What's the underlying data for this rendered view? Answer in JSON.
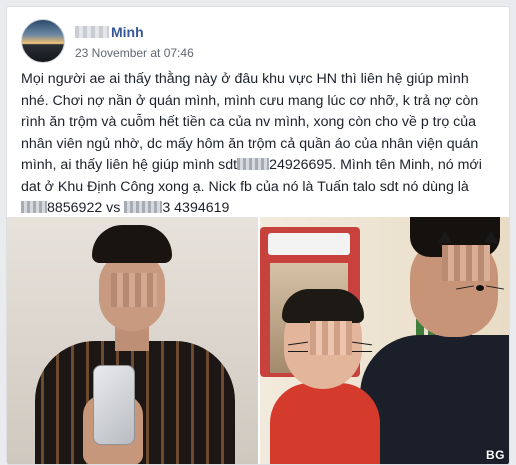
{
  "post": {
    "author": {
      "name_visible": "Minh",
      "avatar_icon": "profile-avatar-icon"
    },
    "timestamp": "23 November at 07:46",
    "lines": [
      "Mọi người ae ai thấy thằng này ở đâu khu vực HN thì liên hệ giúp mình",
      "nhé. Chơi nợ nần ở quán mình, mình cưu mang lúc cơ nhỡ, k trả nợ còn",
      "rình ăn trộm và cuỗm hết tiền ca của nv mình, xong còn cho về p trọ của",
      "nhân viên ngủ nhờ, dc mấy hôm ăn trộm cả quần áo của nhân viện quán",
      "mình, ai thấy liên hệ giúp mình sdt",
      "24926695. Mình tên Minh, nó mới",
      "dat ở Khu Định Công xong ạ. Nick fb của nó là Tuấn talo sdt nó dùng là",
      "8856922 vs",
      "3 4394619"
    ],
    "photos": {
      "left_icon": "photo-man-selfie-icon",
      "right_icon": "photo-man-and-child-icon",
      "watermark": "BG"
    }
  },
  "colors": {
    "author_link": "#365899",
    "text": "#1d2129",
    "meta": "#616770",
    "card_border": "#dddfe2",
    "background": "#e9ebee"
  }
}
